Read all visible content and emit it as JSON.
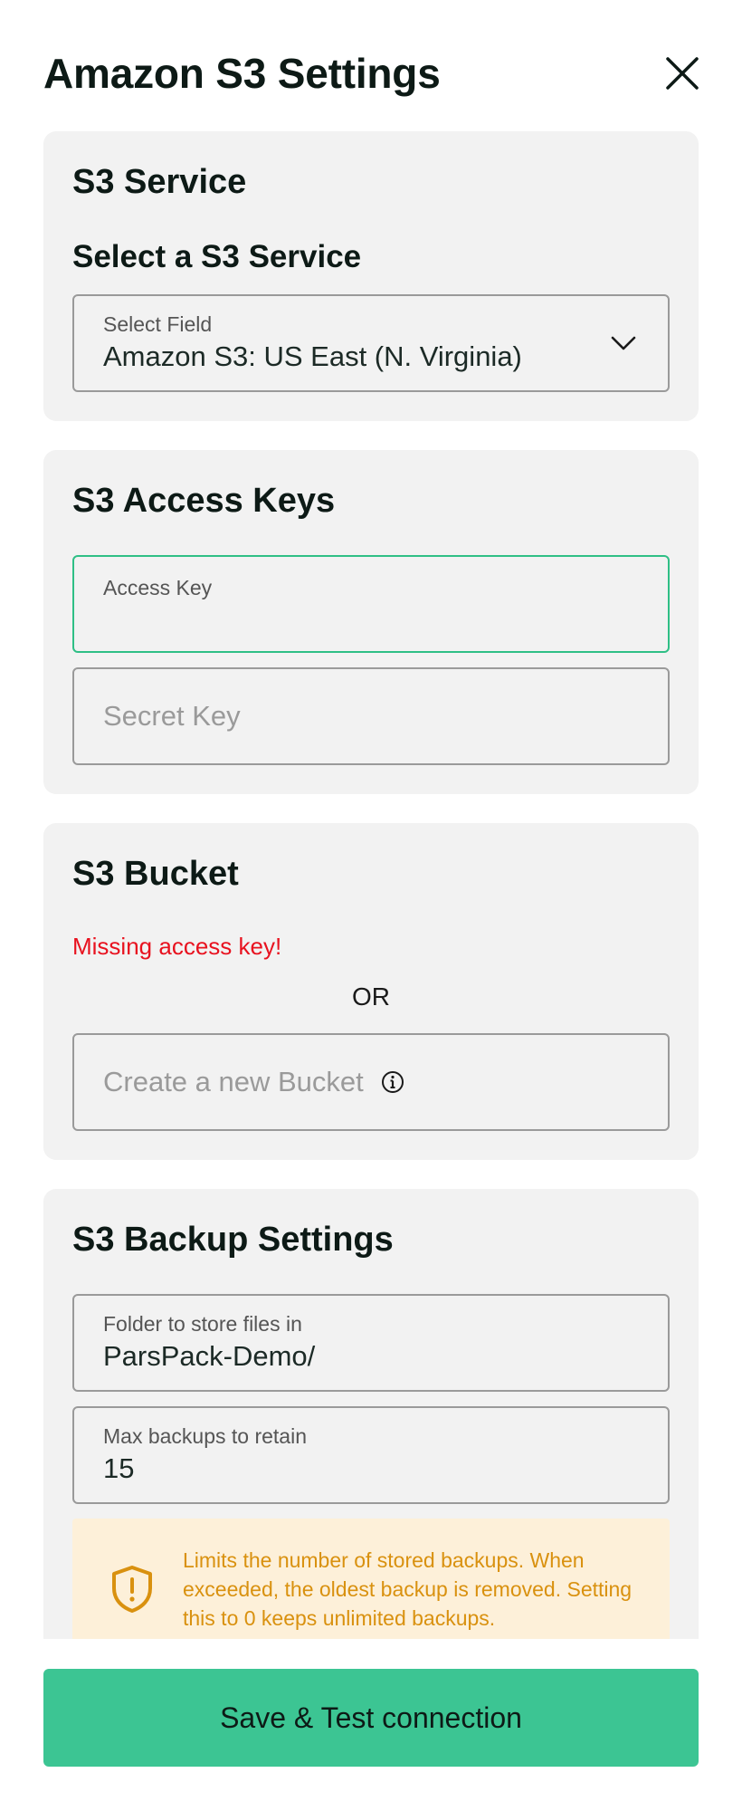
{
  "header": {
    "title": "Amazon S3 Settings"
  },
  "service_card": {
    "title": "S3 Service",
    "subtitle": "Select a S3 Service",
    "select": {
      "label": "Select Field",
      "value": "Amazon S3: US East (N. Virginia)"
    }
  },
  "keys_card": {
    "title": "S3 Access Keys",
    "access_key": {
      "label": "Access Key",
      "value": ""
    },
    "secret_key": {
      "placeholder": "Secret Key"
    }
  },
  "bucket_card": {
    "title": "S3 Bucket",
    "error": "Missing access key!",
    "or": "OR",
    "new_bucket": {
      "placeholder": "Create a new Bucket"
    }
  },
  "backup_card": {
    "title": "S3 Backup Settings",
    "folder": {
      "label": "Folder to store files in",
      "value": "ParsPack-Demo/"
    },
    "max_backups": {
      "label": "Max backups to retain",
      "value": "15"
    },
    "warning": "Limits the number of stored backups. When exceeded, the oldest backup is removed. Setting this to 0 keeps unlimited backups."
  },
  "footer": {
    "save_label": "Save & Test connection"
  },
  "colors": {
    "accent": "#3cc593",
    "error": "#e8121f",
    "warning_text": "#d9910f",
    "warning_bg": "#fdf0d9",
    "card_bg": "#f2f2f2"
  },
  "icons": {
    "close": "close-icon",
    "chevron": "chevron-down-icon",
    "info": "info-icon",
    "warning": "shield-warning-icon"
  }
}
